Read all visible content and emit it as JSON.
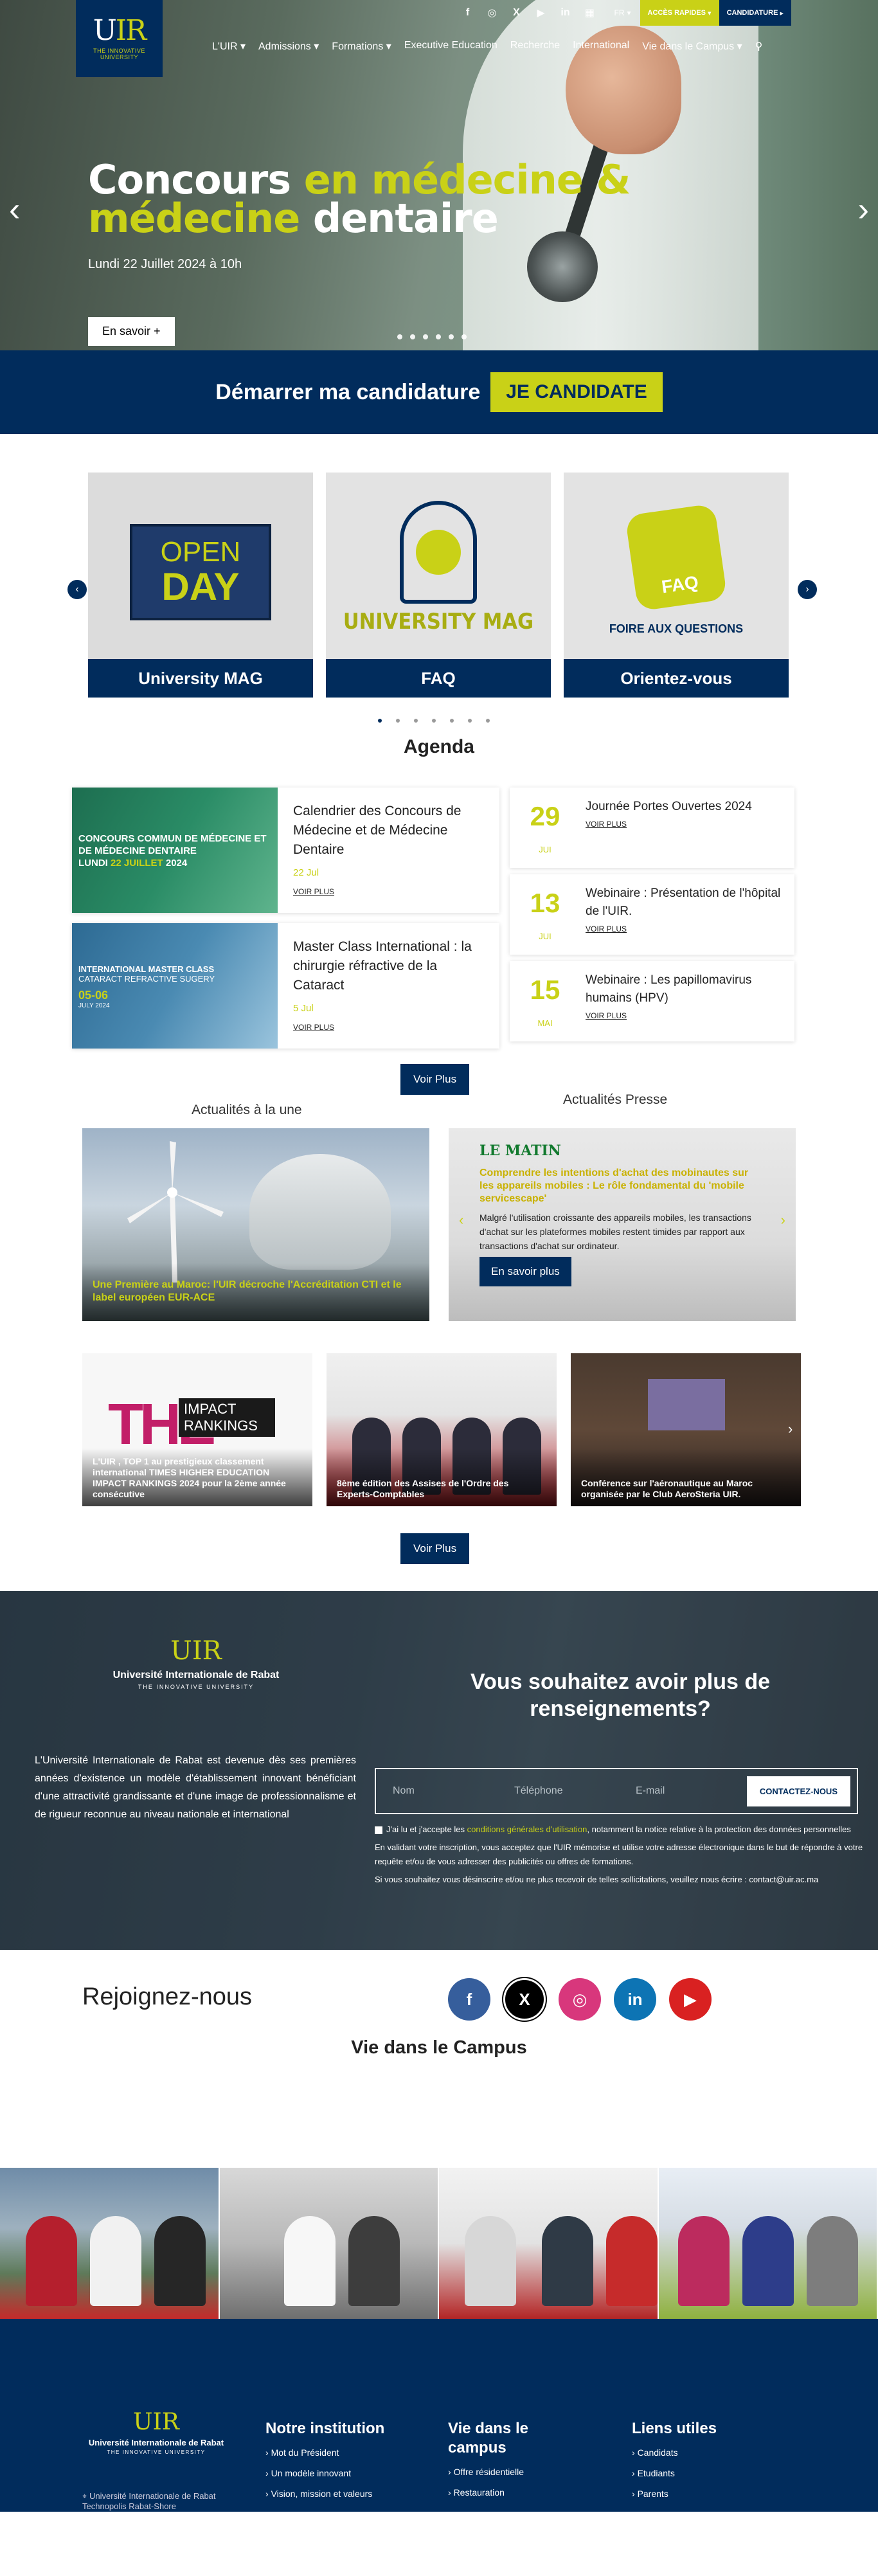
{
  "header": {
    "logo_mark": "UIR",
    "logo_tagline": "THE INNOVATIVE UNIVERSITY",
    "social_icons": [
      "facebook-icon",
      "instagram-icon",
      "x-icon",
      "youtube-icon",
      "linkedin-icon",
      "calendar-icon"
    ],
    "lang": "FR",
    "quick_access": "ACCÈS RAPIDES",
    "candidature": "CANDIDATURE",
    "nav": [
      "L'UIR",
      "Admissions",
      "Formations",
      "Executive Education",
      "Recherche",
      "International",
      "Vie dans le Campus"
    ]
  },
  "hero": {
    "title_a": "Concours ",
    "title_b": "en médecine &",
    "title_c": "médecine",
    "title_d": " dentaire",
    "date": "Lundi 22 Juillet 2024 à 10h",
    "more": "En savoir +"
  },
  "apply": {
    "text": "Démarrer ma candidature",
    "button": "JE CANDIDATE"
  },
  "cards": [
    {
      "caption": "University MAG",
      "art_a": "OPEN",
      "art_b": "DAY"
    },
    {
      "caption": "FAQ",
      "art_a": "UNIVERSITY MAG"
    },
    {
      "caption": "Orientez-vous",
      "art_a": "FAQ",
      "art_b": "FOIRE AUX QUESTIONS"
    }
  ],
  "agenda": {
    "title": "Agenda",
    "featured": [
      {
        "title": "Calendrier des Concours de Médecine et de Médecine Dentaire",
        "date": "22 Jul",
        "link": "VOIR PLUS",
        "thumb_l1": "CONCOURS COMMUN DE MÉDECINE ET DE MÉDECINE DENTAIRE",
        "thumb_l2": "LUNDI ",
        "thumb_l3": "22 JUILLET",
        "thumb_l4": " 2024"
      },
      {
        "title": "Master Class International : la chirurgie réfractive de la Cataract",
        "date": "5 Jul",
        "link": "VOIR PLUS",
        "thumb_l1": "INTERNATIONAL MASTER CLASS",
        "thumb_l2": "CATARACT REFRACTIVE SUGERY",
        "thumb_l3": "05-06",
        "thumb_l4": "JULY 2024"
      }
    ],
    "events": [
      {
        "day": "29",
        "month": "JUI",
        "title": "Journée Portes Ouvertes 2024",
        "link": "VOIR PLUS"
      },
      {
        "day": "13",
        "month": "JUI",
        "title": "Webinaire : Présentation de l'hôpital de l'UIR.",
        "link": "VOIR PLUS"
      },
      {
        "day": "15",
        "month": "MAI",
        "title": "Webinaire : Les papillomavirus humains (HPV)",
        "link": "VOIR PLUS"
      }
    ],
    "more": "Voir Plus"
  },
  "news": {
    "heading_left": "Actualités à la une",
    "heading_right": "Actualités Presse",
    "main_caption": "Une Première au Maroc: l'UIR décroche l'Accréditation CTI et le label européen EUR-ACE",
    "press_logo": "LE MATIN",
    "press_title": "Comprendre les intentions d'achat des mobinautes sur les appareils mobiles : Le rôle fondamental du 'mobile servicescape'",
    "press_text": "Malgré l'utilisation croissante des appareils mobiles, les transactions d'achat sur les plateformes mobiles restent timides par rapport aux transactions d'achat sur ordinateur.",
    "press_button": "En savoir plus",
    "thumbs": [
      {
        "caption": "L'UIR , TOP 1 au prestigieux classement international TIMES HIGHER EDUCATION IMPACT RANKINGS 2024 pour la 2ème année consécutive",
        "art_a": "THE",
        "art_b": "IMPACT RANKINGS"
      },
      {
        "caption": "8ème édition des Assises de l'Ordre des Experts-Comptables"
      },
      {
        "caption": "Conférence sur l'aéronautique au Maroc organisée par le Club AeroSteria UIR."
      }
    ],
    "more": "Voir Plus"
  },
  "contact": {
    "logo_name": "Université Internationale de Rabat",
    "logo_tag": "THE INNOVATIVE UNIVERSITY",
    "description": "L'Université Internationale de Rabat est devenue dès ses premières années d'existence un modèle d'établissement innovant bénéficiant d'une attractivité grandissante et d'une image de professionnalisme et de rigueur reconnue au niveau nationale et international",
    "question": "Vous souhaitez avoir plus de renseignements?",
    "fields": [
      "Nom",
      "Téléphone",
      "E-mail"
    ],
    "submit": "CONTACTEZ-NOUS",
    "consent_a": "J'ai lu et j'accepte les ",
    "consent_link": "conditions générales d'utilisation",
    "consent_b": ", notamment la notice relative à la protection des données personnelles",
    "legal_1": "En validant votre inscription, vous acceptez que l'UIR mémorise et utilise votre adresse électronique dans le but de répondre à votre requête et/ou de vous adresser des publicités ou offres de formations.",
    "legal_2": "Si vous souhaitez vous désinscrire et/ou ne plus recevoir de telles sollicitations, veuillez nous écrire : contact@uir.ac.ma"
  },
  "join": {
    "title": "Rejoignez-nous",
    "icons": [
      "facebook-icon",
      "x-icon",
      "instagram-icon",
      "linkedin-icon",
      "youtube-icon"
    ],
    "campus_title": "Vie dans le Campus"
  },
  "footer": {
    "logo_name": "Université Internationale de Rabat",
    "logo_tag": "THE INNOVATIVE UNIVERSITY",
    "address": "Université Internationale de Rabat Technopolis Rabat-Shore",
    "cols": [
      {
        "title": "Notre institution",
        "items": [
          "Mot du Président",
          "Un modèle innovant",
          "Vision, mission et valeurs"
        ]
      },
      {
        "title": "Vie dans le campus",
        "items": [
          "Offre résidentielle",
          "Restauration"
        ]
      },
      {
        "title": "Liens utiles",
        "items": [
          "Candidats",
          "Etudiants",
          "Parents"
        ]
      }
    ]
  },
  "colors": {
    "navy": "#012c5c",
    "lime": "#c9d117"
  }
}
